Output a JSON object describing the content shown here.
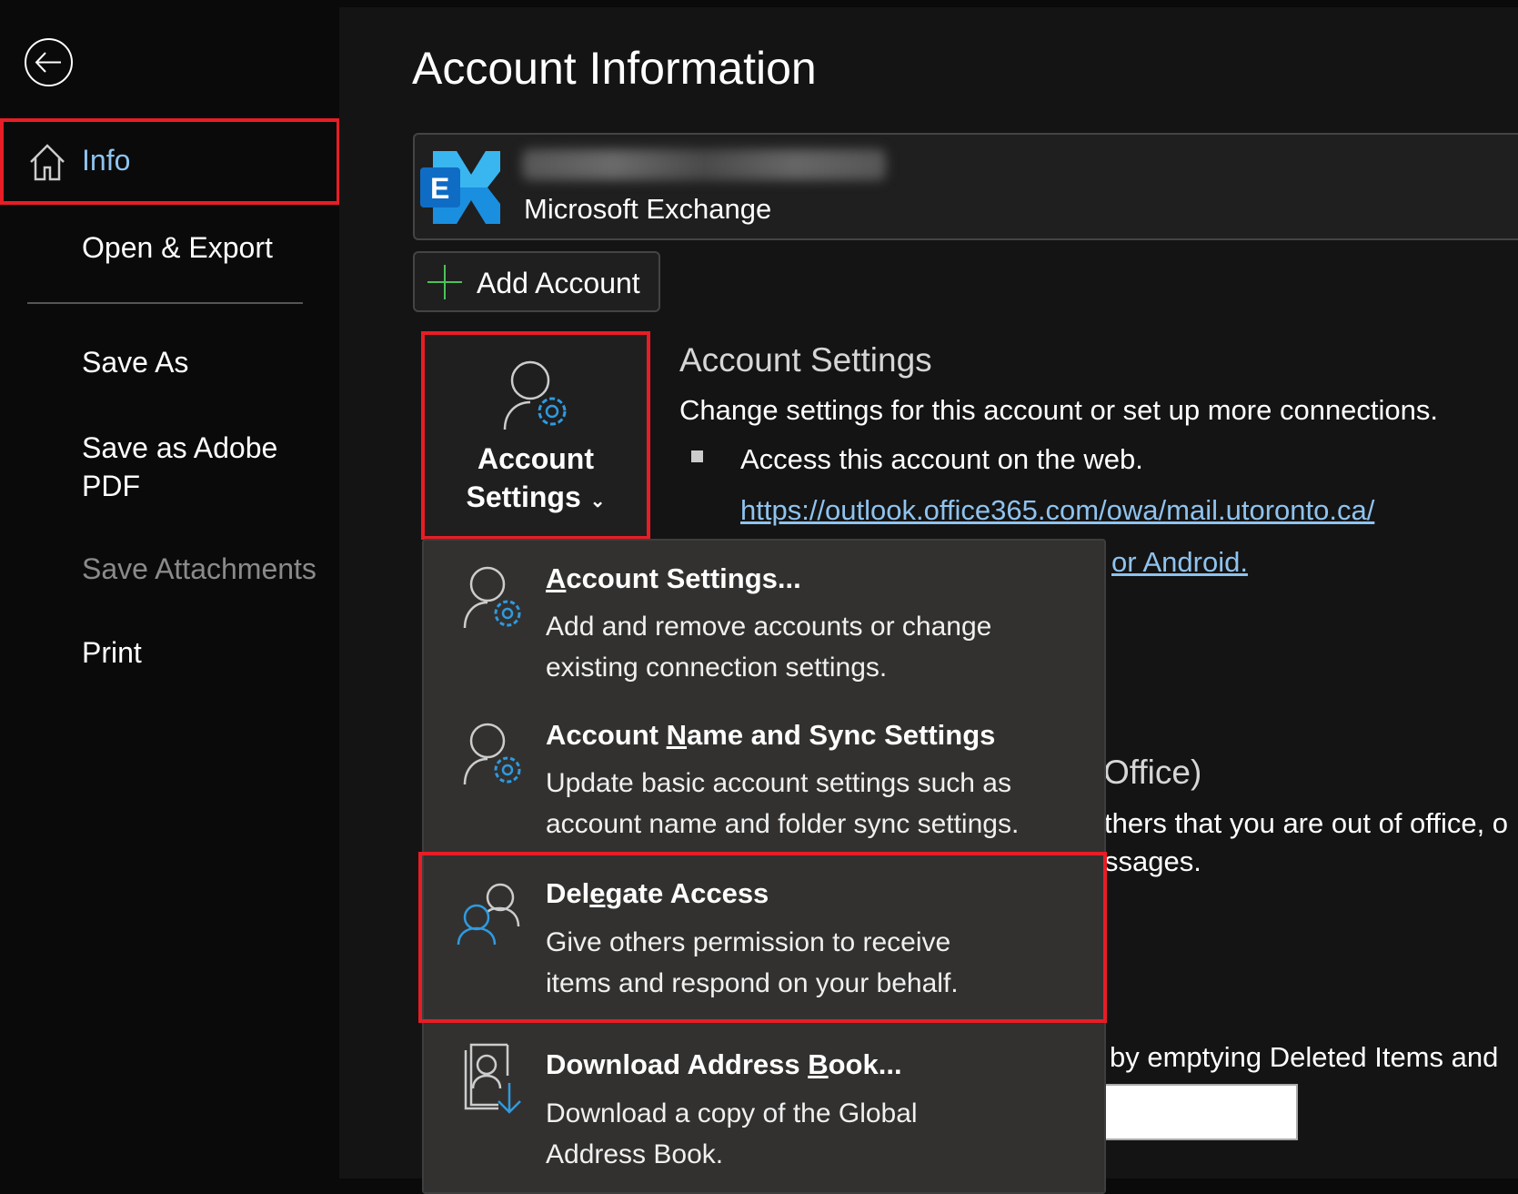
{
  "sidebar": {
    "back_icon": "back-arrow-circle-icon",
    "items": [
      {
        "label": "Info",
        "icon": "home-icon",
        "selected": true
      },
      {
        "label": "Open & Export"
      },
      {
        "label": "Save As"
      },
      {
        "label": "Save as Adobe",
        "label2": "PDF"
      },
      {
        "label": "Save Attachments",
        "disabled": true
      },
      {
        "label": "Print"
      }
    ]
  },
  "main": {
    "title": "Account Information",
    "account": {
      "type": "Microsoft Exchange",
      "icon": "exchange-logo-icon"
    },
    "add_account": "Add Account",
    "account_settings_button": {
      "line1": "Account",
      "line2": "Settings"
    },
    "section": {
      "heading": "Account Settings",
      "description": "Change settings for this account or set up more connections.",
      "bullet": "Access this account on the web.",
      "link": "https://outlook.office365.com/owa/mail.utoronto.ca/",
      "link2_partial": "or Android."
    },
    "partial": {
      "heading": "Office)",
      "line1": "thers that you are out of office, o",
      "line2": "ssages.",
      "line3": "by emptying Deleted Items and"
    }
  },
  "dropdown": {
    "items": [
      {
        "title_pre": "",
        "title_u": "A",
        "title_post": "ccount Settings...",
        "desc1": "Add and remove accounts or change",
        "desc2": "existing connection settings.",
        "icon": "person-gear-icon"
      },
      {
        "title_pre": "Account ",
        "title_u": "N",
        "title_post": "ame and Sync Settings",
        "desc1": "Update basic account settings such as",
        "desc2": "account name and folder sync settings.",
        "icon": "person-gear-icon"
      },
      {
        "title_pre": "Del",
        "title_u": "e",
        "title_post": "gate Access",
        "desc1": "Give others permission to receive",
        "desc2": "items and respond on your behalf.",
        "icon": "people-icon",
        "highlighted": true
      },
      {
        "title_pre": "Download Address ",
        "title_u": "B",
        "title_post": "ook...",
        "desc1": "Download a copy of the Global",
        "desc2": "Address Book.",
        "icon": "address-book-download-icon"
      }
    ]
  },
  "colors": {
    "highlight": "#e81d25",
    "accent": "#2f9ae0",
    "link": "#8fc3ee",
    "menu_bg": "#323130"
  }
}
